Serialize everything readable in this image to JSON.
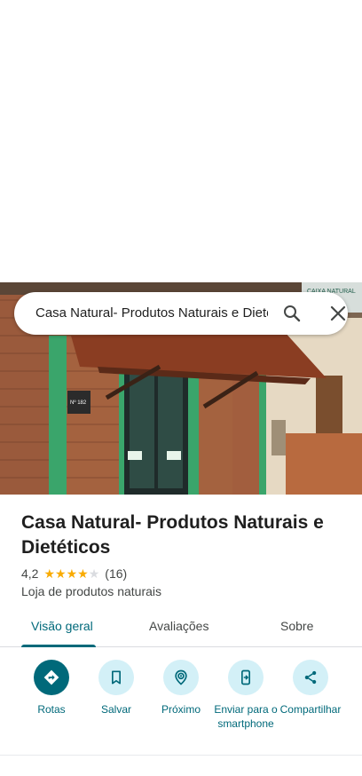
{
  "search": {
    "query": "Casa Natural- Produtos Naturais e Dietéticos"
  },
  "place": {
    "name": "Casa Natural- Produtos Naturais e Dietéticos",
    "rating": "4,2",
    "rating_value": 4.2,
    "review_count": "(16)",
    "category": "Loja de produtos naturais"
  },
  "photo": {
    "sign_text": "CAIXA NATURAL",
    "plaque_text": "Nº 182"
  },
  "tabs": [
    {
      "label": "Visão geral",
      "active": true
    },
    {
      "label": "Avaliações",
      "active": false
    },
    {
      "label": "Sobre",
      "active": false
    }
  ],
  "actions": [
    {
      "label": "Rotas",
      "icon": "directions-icon"
    },
    {
      "label": "Salvar",
      "icon": "bookmark-icon"
    },
    {
      "label": "Próximo",
      "icon": "nearby-icon"
    },
    {
      "label": "Enviar para o smartphone",
      "icon": "send-to-phone-icon"
    },
    {
      "label": "Compartilhar",
      "icon": "share-icon"
    }
  ],
  "colors": {
    "accent": "#00697a",
    "accent_light": "#d3f0f7",
    "star": "#f9ab00"
  }
}
